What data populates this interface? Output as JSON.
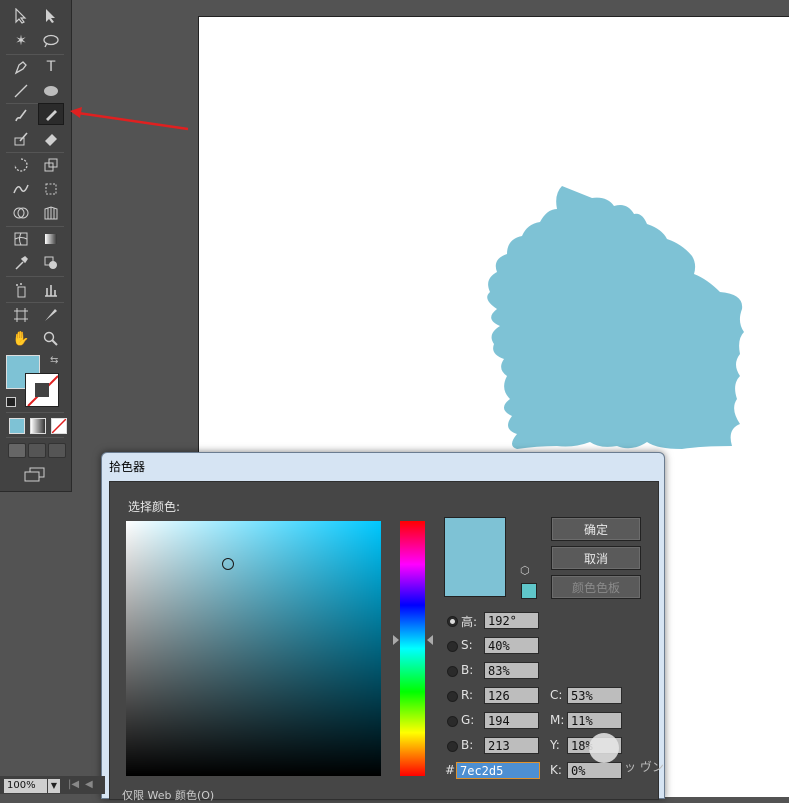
{
  "dialog": {
    "title": "拾色器",
    "select_color_label": "选择颜色:",
    "new_color": "#7ec2d5",
    "web_color": "#5fc6c9",
    "buttons": {
      "ok": "确定",
      "cancel": "取消",
      "swatches": "颜色色板"
    },
    "fields": {
      "h": {
        "label": "高:",
        "value": "192°"
      },
      "s": {
        "label": "S:",
        "value": "40%"
      },
      "b": {
        "label": "B:",
        "value": "83%"
      },
      "r": {
        "label": "R:",
        "value": "126"
      },
      "g": {
        "label": "G:",
        "value": "194"
      },
      "bl": {
        "label": "B:",
        "value": "213"
      },
      "c": {
        "label": "C:",
        "value": "53%"
      },
      "m": {
        "label": "M:",
        "value": "11%"
      },
      "y": {
        "label": "Y:",
        "value": "18%"
      },
      "k": {
        "label": "K:",
        "value": "0%"
      },
      "hex": {
        "label": "#",
        "value": "7ec2d5"
      }
    },
    "bottom_option": "仅限 Web 颜色(O)"
  },
  "toolbar": {
    "fill_color": "#7ec2d5",
    "type_glyph": "T"
  },
  "status": {
    "zoom": "100%"
  },
  "watermark": {
    "text": "ッ ヴン"
  },
  "colors": {
    "annotation_arrow": "#e02020",
    "shape_fill": "#7ec2d5"
  }
}
